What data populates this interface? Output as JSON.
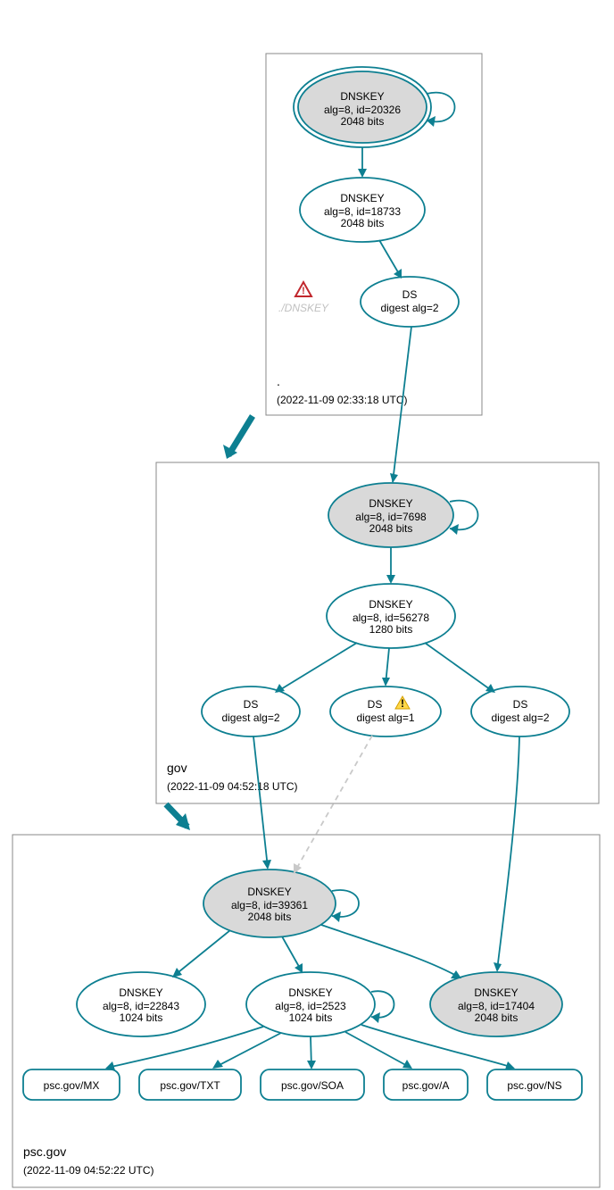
{
  "zones": {
    "root": {
      "label": ".",
      "timestamp": "(2022-11-09 02:33:18 UTC)"
    },
    "gov": {
      "label": "gov",
      "timestamp": "(2022-11-09 04:52:18 UTC)"
    },
    "psc": {
      "label": "psc.gov",
      "timestamp": "(2022-11-09 04:52:22 UTC)"
    }
  },
  "nodes": {
    "root_ksk": {
      "title": "DNSKEY",
      "line2": "alg=8, id=20326",
      "line3": "2048 bits"
    },
    "root_zsk": {
      "title": "DNSKEY",
      "line2": "alg=8, id=18733",
      "line3": "2048 bits"
    },
    "root_ds": {
      "title": "DS",
      "line2": "digest alg=2"
    },
    "root_badkey": {
      "label": "./DNSKEY"
    },
    "gov_ksk": {
      "title": "DNSKEY",
      "line2": "alg=8, id=7698",
      "line3": "2048 bits"
    },
    "gov_zsk": {
      "title": "DNSKEY",
      "line2": "alg=8, id=56278",
      "line3": "1280 bits"
    },
    "gov_ds1": {
      "title": "DS",
      "line2": "digest alg=2"
    },
    "gov_ds2": {
      "title": "DS",
      "line2": "digest alg=1",
      "warn": true
    },
    "gov_ds3": {
      "title": "DS",
      "line2": "digest alg=2"
    },
    "psc_ksk": {
      "title": "DNSKEY",
      "line2": "alg=8, id=39361",
      "line3": "2048 bits"
    },
    "psc_zsk1": {
      "title": "DNSKEY",
      "line2": "alg=8, id=22843",
      "line3": "1024 bits"
    },
    "psc_zsk2": {
      "title": "DNSKEY",
      "line2": "alg=8, id=2523",
      "line3": "1024 bits"
    },
    "psc_ksk2": {
      "title": "DNSKEY",
      "line2": "alg=8, id=17404",
      "line3": "2048 bits"
    },
    "rr_mx": {
      "label": "psc.gov/MX"
    },
    "rr_txt": {
      "label": "psc.gov/TXT"
    },
    "rr_soa": {
      "label": "psc.gov/SOA"
    },
    "rr_a": {
      "label": "psc.gov/A"
    },
    "rr_ns": {
      "label": "psc.gov/NS"
    }
  }
}
